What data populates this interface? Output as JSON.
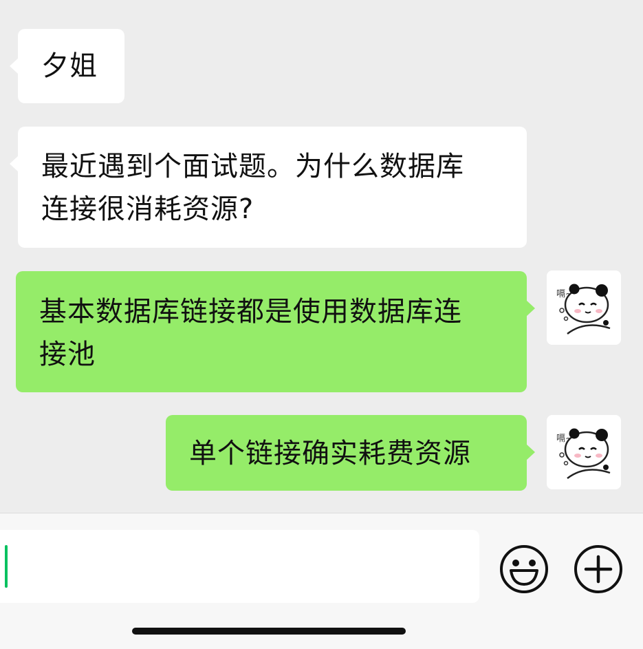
{
  "messages": [
    {
      "direction": "incoming",
      "text": "夕姐"
    },
    {
      "direction": "incoming",
      "lines": [
        "最近遇到个面试题。为什么数据库",
        "连接很消耗资源?"
      ]
    },
    {
      "direction": "outgoing",
      "lines": [
        "基本数据库链接都是使用数据库连",
        "接池"
      ],
      "avatar_caption": "嗝~"
    },
    {
      "direction": "outgoing",
      "text": "单个链接确实耗费资源",
      "avatar_caption": "嗝~"
    }
  ],
  "input": {
    "value": ""
  },
  "icons": {
    "emoji": "smiley-face-icon",
    "more": "plus-circle-icon"
  },
  "colors": {
    "background": "#ededed",
    "incoming_bubble": "#ffffff",
    "outgoing_bubble": "#95ec69",
    "caret": "#07c160"
  }
}
